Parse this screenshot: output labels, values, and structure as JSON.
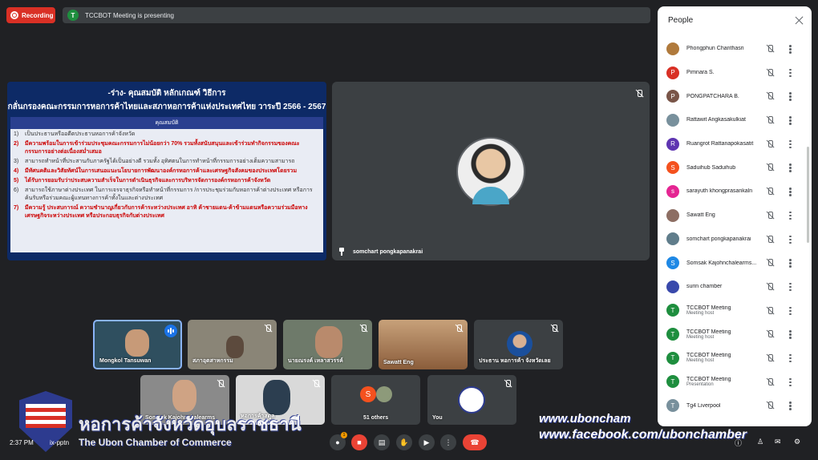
{
  "top": {
    "recording_label": "Recording",
    "presenting_avatar": "T",
    "presenting_text": "TCCBOT Meeting is presenting"
  },
  "slide": {
    "title1": "-ร่าง- คุณสมบัติ หลักเกณฑ์ วิธีการ",
    "title2": "กลั่นกรองคณะกรรมการหอการค้าไทยและสภาหอการค้าแห่งประเทศไทย วาระปี 2566 - 2567",
    "header": "คุณสมบัติ",
    "items": [
      {
        "num": "1)",
        "text": "เป็นประธานหรืออดีตประธานหอการค้าจังหวัด"
      },
      {
        "num": "2)",
        "text": "มีความพร้อมในการเข้าร่วมประชุมคณะกรรมการไม่น้อยกว่า 70% รวมทั้งสนับสนุนและเข้าร่วมทำกิจกรรมของคณะกรรมการอย่างต่อเนื่องสม่ำเสมอ"
      },
      {
        "num": "3)",
        "text": "สามารถทำหน้าที่ประสานกับภาครัฐได้เป็นอย่างดี รวมทั้ง อุทิศตนในการทำหน้าที่กรรมการอย่างเต็มความสามารถ"
      },
      {
        "num": "4)",
        "text": "มีทัศนคติและวิสัยทัศน์ในการเสนอแนะนโยบายการพัฒนาองค์กรหอการค้าและเศรษฐกิจสังคมของประเทศโดยรวม"
      },
      {
        "num": "5)",
        "text": "ได้รับการยอมรับว่าประสบความสำเร็จในการดำเนินธุรกิจและการบริหารจัดการองค์กรหอการค้าจังหวัด"
      },
      {
        "num": "6)",
        "text": "สามารถใช้ภาษาต่างประเทศ ในการเจรจาธุรกิจหรือทำหน้าที่กรรมการ /การประชุมร่วมกับหอการค้าต่างประเทศ หรือการค้นรับหรือร่วมคณะผู้แทนทางการค้าทั้งในและต่างประเทศ"
      },
      {
        "num": "7)",
        "text": "มีความรู้ ประสบการณ์ ความชำนาญเกี่ยวกับการค้าระหว่างประเทศ อาทิ ค้าชายแดน-ค้าข้ามแดนหรือความร่วมมือทางเศรษฐกิจระหว่างประเทศ หรือประกอบธุรกิจกับต่างประเทศ"
      }
    ]
  },
  "main_speaker": {
    "name": "somchart pongkapanakrai"
  },
  "tiles": [
    {
      "name": "Mongkol Tansuwan"
    },
    {
      "name": "สภาอุตสาหกรรม"
    },
    {
      "name": "นายณรงค์ เหลาสวรรค์"
    },
    {
      "name": "Sawatt Eng"
    },
    {
      "name": "ประธาน หอการค้า จังหวัดเลย"
    },
    {
      "name": "Somsak Kajohnchalearms"
    },
    {
      "name": "หอการค้าสตูล"
    },
    {
      "name": "51 others",
      "avatar": "S"
    },
    {
      "name": "You"
    }
  ],
  "people": {
    "title": "People",
    "list": [
      {
        "initial": "",
        "name": "Phongphun Chanthasri",
        "role": "",
        "color": "#b07a3c"
      },
      {
        "initial": "P",
        "name": "Pimnara S.",
        "role": "",
        "color": "#d93025"
      },
      {
        "initial": "P",
        "name": "PONGPATCHARA B.",
        "role": "",
        "color": "#795548"
      },
      {
        "initial": "",
        "name": "Rattawit Angkasakulkiat",
        "role": "",
        "color": "#78909c"
      },
      {
        "initial": "R",
        "name": "Ruangrot Rattanapokasatit",
        "role": "",
        "color": "#5e35b1"
      },
      {
        "initial": "S",
        "name": "Saduihub Saduihub",
        "role": "",
        "color": "#f4511e"
      },
      {
        "initial": "s",
        "name": "sarayuth khongprasankaln",
        "role": "",
        "color": "#e52592"
      },
      {
        "initial": "",
        "name": "Sawatt Eng",
        "role": "",
        "color": "#8d6e63"
      },
      {
        "initial": "",
        "name": "somchart pongkapanakrai",
        "role": "",
        "color": "#607d8b"
      },
      {
        "initial": "S",
        "name": "Somsak Kajohnchalearms...",
        "role": "",
        "color": "#1e88e5"
      },
      {
        "initial": "",
        "name": "surin chamber",
        "role": "",
        "color": "#3949ab"
      },
      {
        "initial": "T",
        "name": "TCCBOT Meeting",
        "role": "Meeting host",
        "color": "#1e8e3e"
      },
      {
        "initial": "T",
        "name": "TCCBOT Meeting",
        "role": "Meeting host",
        "color": "#1e8e3e"
      },
      {
        "initial": "T",
        "name": "TCCBOT Meeting",
        "role": "Meeting host",
        "color": "#1e8e3e"
      },
      {
        "initial": "T",
        "name": "TCCBOT Meeting",
        "role": "Presentation",
        "color": "#1e8e3e"
      },
      {
        "initial": "T",
        "name": "Tg4 Liverpool",
        "role": "",
        "color": "#78909c"
      }
    ]
  },
  "bottom": {
    "time": "2:37 PM",
    "code": "ix-pptn",
    "badge": "1"
  },
  "watermark": {
    "thai": "หอการค้าจังหวัดอุบลราชธานี",
    "english": "The Ubon Chamber of Commerce",
    "url1": "www.uboncham",
    "url2": "www.facebook.com/ubonchamber"
  }
}
